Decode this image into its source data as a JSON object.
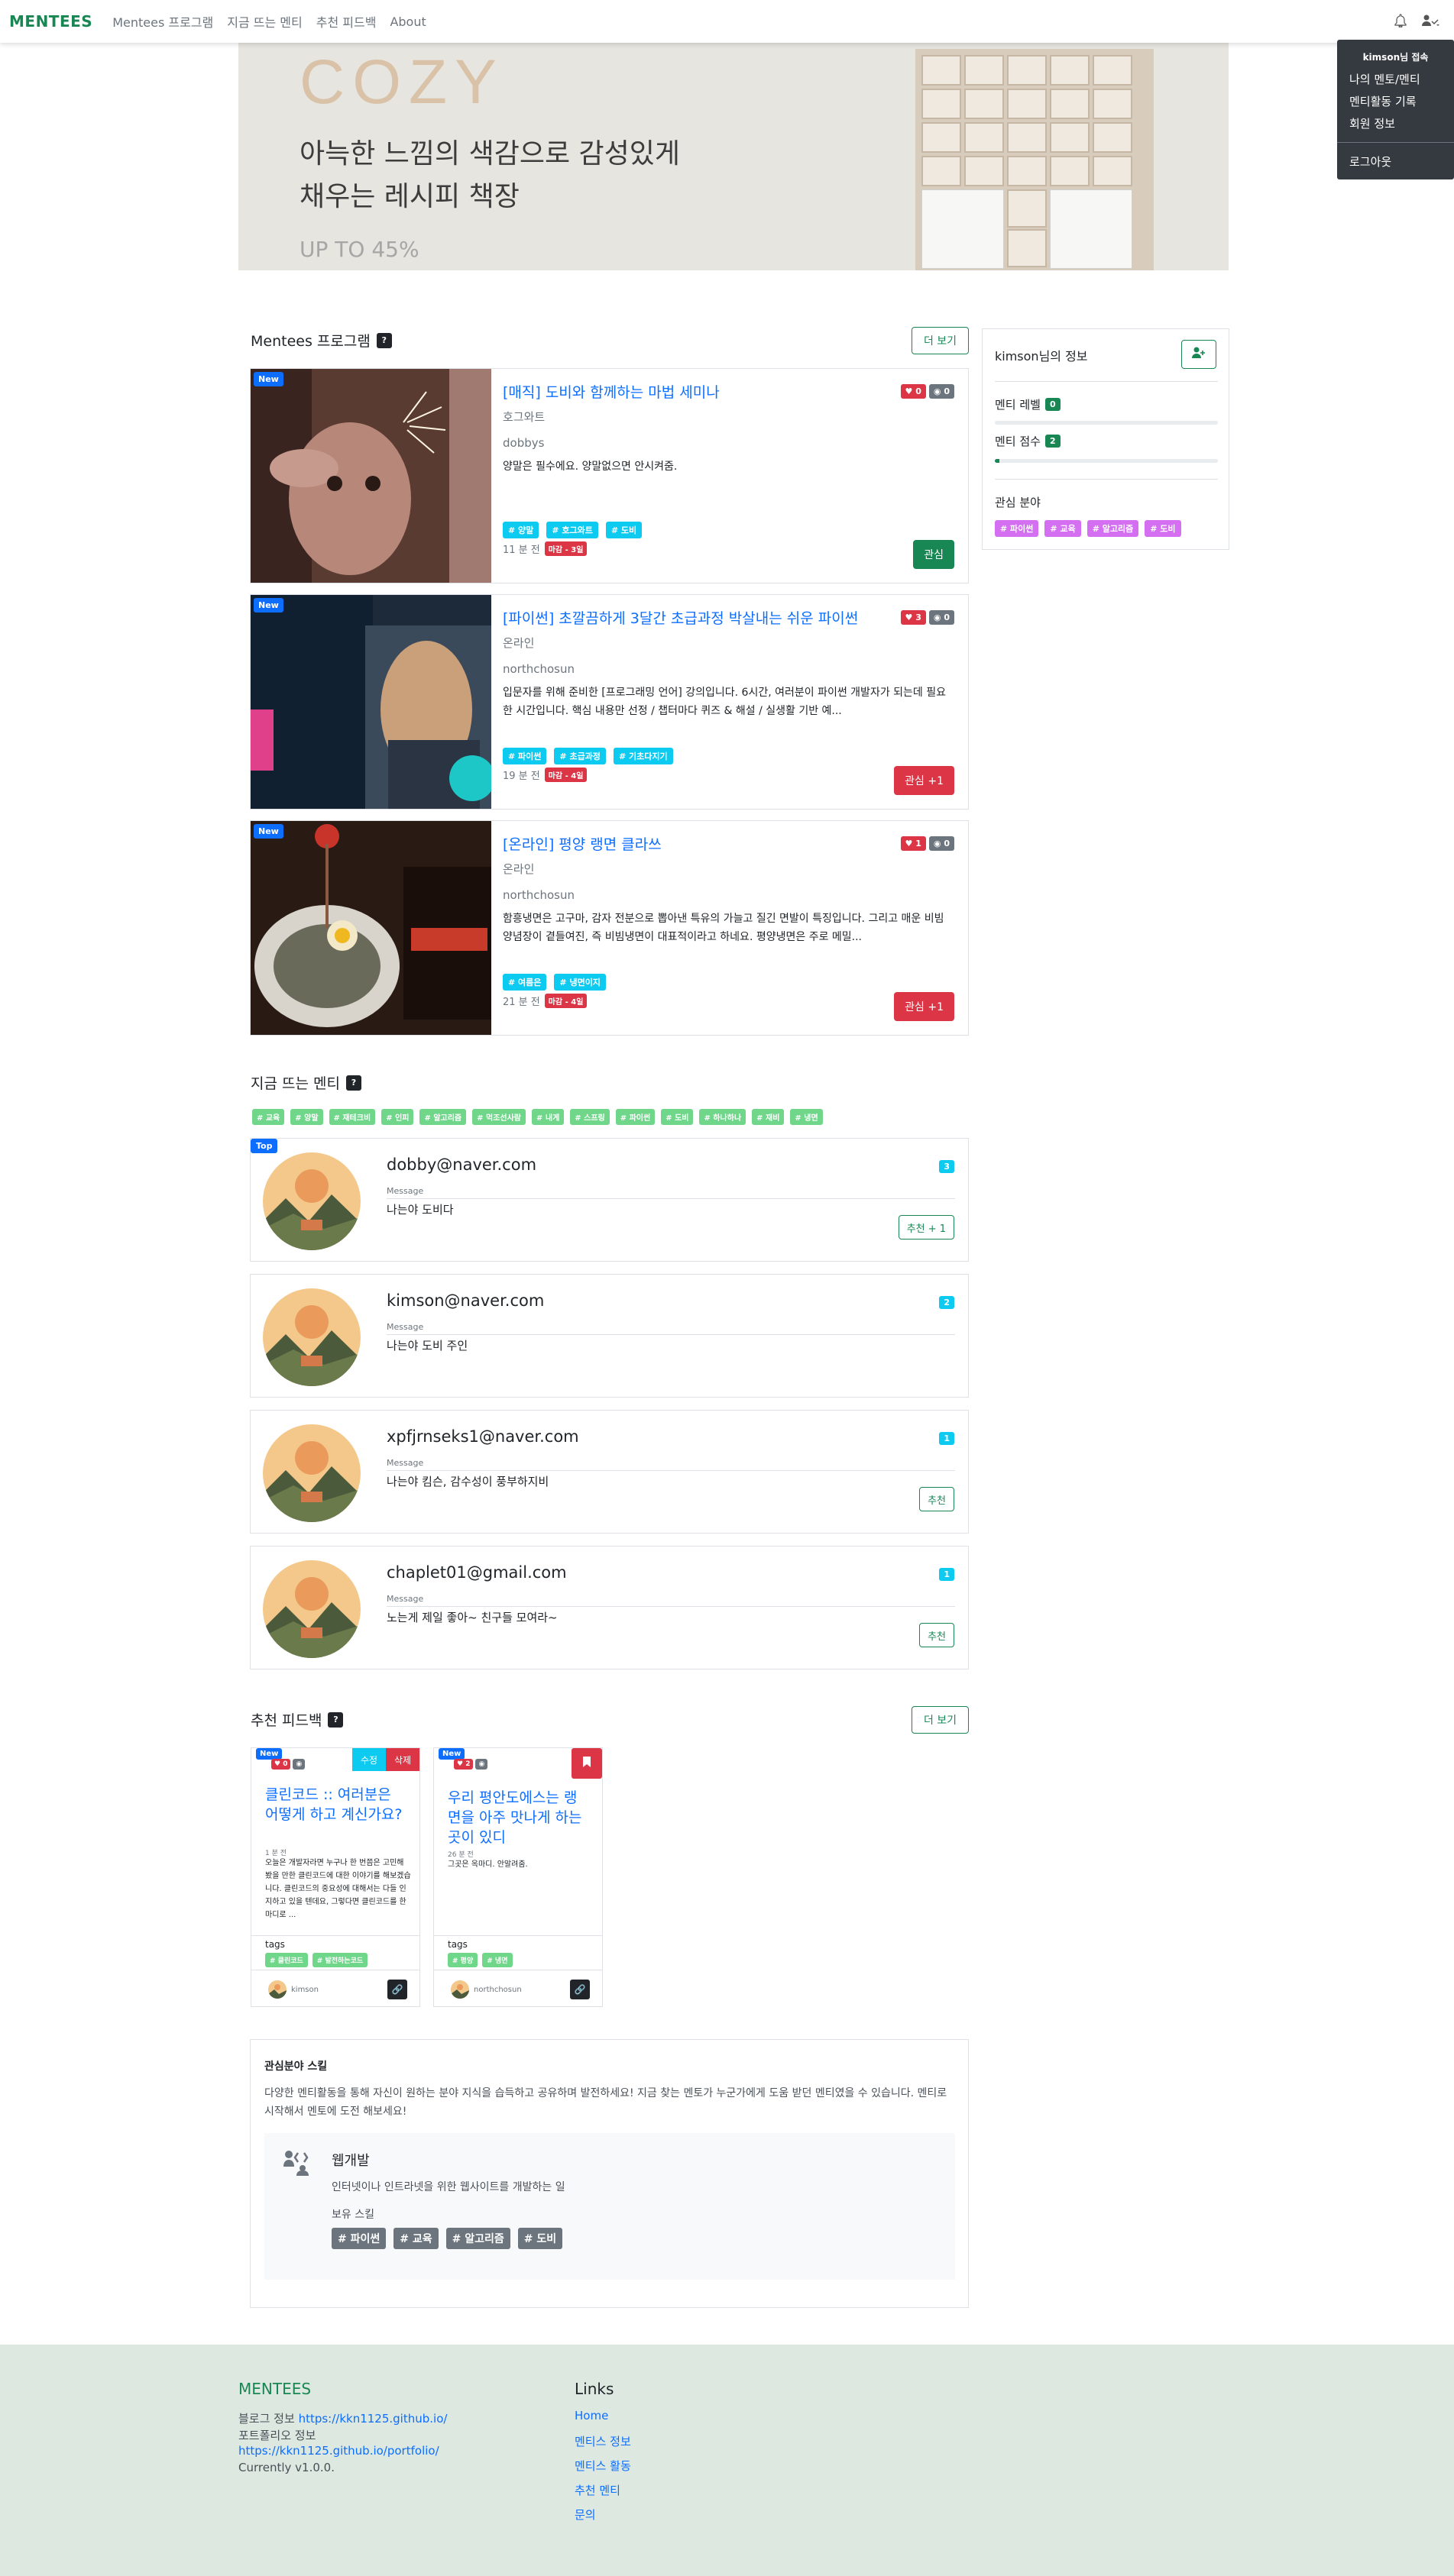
{
  "nav": {
    "brand": "MENTEES",
    "links": [
      "Mentees 프로그램",
      "지금 뜨는 멘티",
      "추천 피드백",
      "About"
    ]
  },
  "dropdown": {
    "header": "kimson님 접속",
    "items": [
      "나의 멘토/멘티",
      "멘티활동 기록",
      "회원 정보"
    ],
    "logout": "로그아웃"
  },
  "banner": {
    "brand": "COZY",
    "line1": "아늑한 느낌의 색감으로 감성있게",
    "line2": "채우는 레시피 책장",
    "sale": "UP TO 45%"
  },
  "programs": {
    "title": "Mentees 프로그램",
    "help": "?",
    "more": "더 보기",
    "cards": [
      {
        "badge": "New",
        "title": "[매직] 도비와 함께하는 마법 세미나",
        "location": "호그와트",
        "author": "dobbys",
        "desc": "양말은 필수에요. 양말없으면 안시켜줌.",
        "tags": [
          "# 양말",
          "# 호그와트",
          "# 도비"
        ],
        "time": "11 분 전",
        "status": "마감 - 3일",
        "likes": "0",
        "views": "0",
        "action": "관심",
        "action_color": "#198754"
      },
      {
        "badge": "New",
        "title": "[파이썬] 초깔끔하게 3달간 초급과정 박살내는 쉬운 파이썬",
        "location": "온라인",
        "author": "northchosun",
        "desc": "입문자를 위해 준비한 [프로그래밍 언어] 강의입니다. 6시간, 여러분이 파이썬 개발자가 되는데 필요한 시간입니다. 핵심 내용만 선정 / 챕터마다 퀴즈 & 해설 / 실생활 기반 예...",
        "tags": [
          "# 파이썬",
          "# 초급과정",
          "# 기초다지기"
        ],
        "time": "19 분 전",
        "status": "마감 - 4일",
        "likes": "3",
        "views": "0",
        "action": "관심 +1",
        "action_color": "#dc3545"
      },
      {
        "badge": "New",
        "title": "[온라인] 평양 랭면 클라쓰",
        "location": "온라인",
        "author": "northchosun",
        "desc": "함흥냉면은 고구마, 감자 전분으로 뽑아낸 특유의 가늘고 질긴 면발이 특징입니다. 그리고 매운 비빔양념장이 곁들여진, 즉 비빔냉면이 대표적이라고 하네요. 평양냉면은 주로 메밀...",
        "tags": [
          "# 여름은",
          "# 냉면이지"
        ],
        "time": "21 분 전",
        "status": "마감 - 4일",
        "likes": "1",
        "views": "0",
        "action": "관심 +1",
        "action_color": "#dc3545"
      }
    ]
  },
  "info": {
    "name": "kimson님의 정보",
    "level_label": "멘티 레벨",
    "level": "0",
    "score_label": "멘티 점수",
    "score": "2",
    "level_progress": 0,
    "score_progress": 0.02,
    "interest_label": "관심 분야",
    "interests": [
      "# 파이썬",
      "# 교육",
      "# 알고리즘",
      "# 도비"
    ]
  },
  "trending": {
    "title": "지금 뜨는 멘티",
    "help": "?",
    "keywords": [
      "# 교육",
      "# 양말",
      "# 재테크비",
      "# 인피",
      "# 알고리즘",
      "# 먹조선사람",
      "# 내게",
      "# 스프링",
      "# 파이썬",
      "# 도비",
      "# 하나하나",
      "# 재비",
      "# 냉면"
    ],
    "mentees": [
      {
        "badge": "Top",
        "email": "dobby@naver.com",
        "msg_label": "Message",
        "message": "나는야 도비다",
        "count": "3",
        "rec": "추천 + 1"
      },
      {
        "badge": "",
        "email": "kimson@naver.com",
        "msg_label": "Message",
        "message": "나는야 도비 주인",
        "count": "2",
        "rec": ""
      },
      {
        "badge": "",
        "email": "xpfjrnseks1@naver.com",
        "msg_label": "Message",
        "message": "나는야 킴슨, 감수성이 풍부하지비",
        "count": "1",
        "rec": "추천"
      },
      {
        "badge": "",
        "email": "chaplet01@gmail.com",
        "msg_label": "Message",
        "message": "노는게 제일 좋아~ 친구들 모여라~",
        "count": "1",
        "rec": "추천"
      }
    ]
  },
  "feedback": {
    "title": "추천 피드백",
    "help": "?",
    "more": "더 보기",
    "cards": [
      {
        "badge": "New",
        "likes": "0",
        "views": "",
        "edit": "수정",
        "delete": "삭제",
        "title": "클린코드 :: 여러분은 어떻게 하고 계신가요?",
        "date": "1 분 전",
        "desc": "오늘은 개발자라면 누구나 한 번쯤은 고민해 봤을 만한 클린코드에 대한 이야기를 해보겠습니다. 클린코드의 중요성에 대해서는 다들 인지하고 있을 텐데요, 그렇다면 클린코드를 한마디로 ...",
        "tags_label": "tags",
        "tags": [
          "# 클린코드",
          "# 발전하는코드"
        ],
        "user": "kimson"
      },
      {
        "badge": "New",
        "likes": "2",
        "views": "",
        "title": "우리 평안도에스는 랭면을 아주 맛나게 하는 곳이 있디",
        "date": "26 분 전",
        "desc": "그곳은 옥마디. 안알려줌.",
        "tags_label": "tags",
        "tags": [
          "# 평양",
          "# 냉면"
        ],
        "user": "northchosun"
      }
    ]
  },
  "skill": {
    "title": "관심분야 스킬",
    "desc": "다양한 멘티활동을 통해 자신이 원하는 분야 지식을 습득하고 공유하며 발전하세요! 지금 찾는 멘토가 누군가에게 도움 받던 멘티였을 수 있습니다. 멘티로 시작해서 멘토에 도전 해보세요!",
    "name": "웹개발",
    "sub": "인터넷이나 인트라넷을 위한 웹사이트를 개발하는 일",
    "owned": "보유 스킬",
    "tags": [
      "# 파이썬",
      "# 교육",
      "# 알고리즘",
      "# 도비"
    ]
  },
  "footer": {
    "brand": "MENTEES",
    "blog_label": "블로그 정보",
    "blog_url": "https://kkn1125.github.io/",
    "portfolio_label": "포트폴리오 정보",
    "portfolio_url": "https://kkn1125.github.io/portfolio/",
    "version": "Currently v1.0.0.",
    "links_title": "Links",
    "links": [
      "Home",
      "멘티스 정보",
      "멘티스 활동",
      "추천 멘티",
      "문의"
    ]
  },
  "colors": {
    "brand": "#198754",
    "primary": "#0d6efd",
    "danger": "#dc3545",
    "info": "#0dcaf0",
    "footer_bg": "#dce8e0"
  }
}
